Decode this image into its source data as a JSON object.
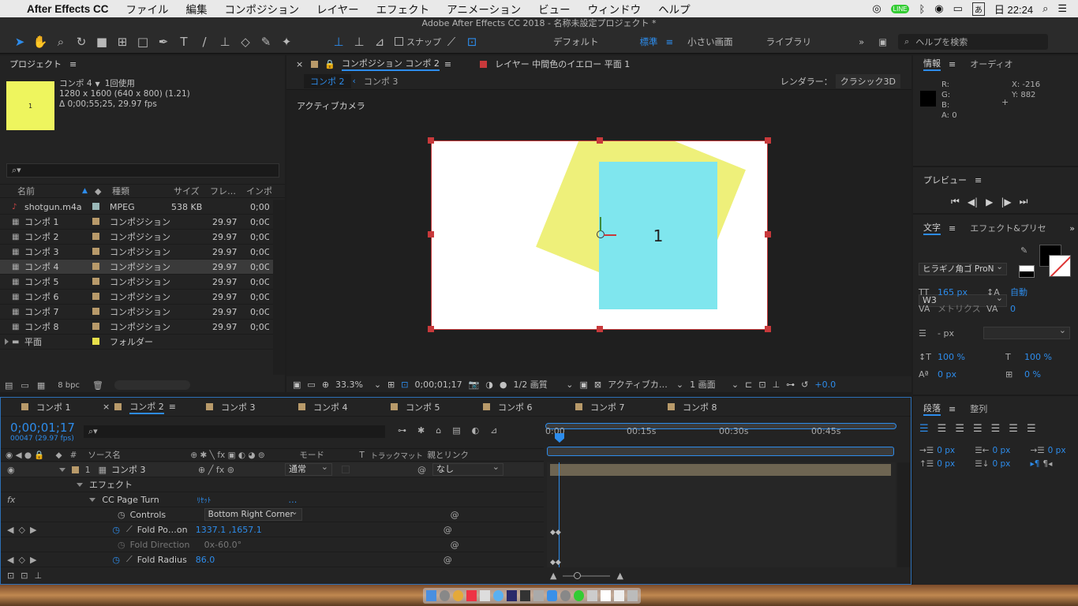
{
  "menubar": {
    "app": "After Effects CC",
    "items": [
      "ファイル",
      "編集",
      "コンポジション",
      "レイヤー",
      "エフェクト",
      "アニメーション",
      "ビュー",
      "ウィンドウ",
      "ヘルプ"
    ],
    "clock": "日 22:24"
  },
  "titlebar": "Adobe After Effects CC 2018 - 名称未設定プロジェクト *",
  "toolbar": {
    "snap": "スナップ",
    "workspaces": [
      "デフォルト",
      "標準",
      "小さい画面",
      "ライブラリ"
    ],
    "active_workspace": "標準",
    "help_placeholder": "ヘルプを検索"
  },
  "project": {
    "title": "プロジェクト",
    "item_name": "コンポ 4",
    "usage": "1回使用",
    "dims": "1280 x 1600  (640 x 800) (1.21)",
    "duration": "Δ 0;00;55;25, 29.97 fps",
    "thumb_text": "1",
    "columns": [
      "名前",
      "種類",
      "サイズ",
      "フレ…",
      "インポ"
    ],
    "rows": [
      {
        "name": "shotgun.m4a",
        "type": "MPEG",
        "size": "538 KB",
        "fps": "",
        "in": "0;00",
        "color": "#9ab8b8"
      },
      {
        "name": "コンポ 1",
        "type": "コンポジション",
        "size": "",
        "fps": "29.97",
        "in": "0;0C",
        "color": "#b89a6a"
      },
      {
        "name": "コンポ 2",
        "type": "コンポジション",
        "size": "",
        "fps": "29.97",
        "in": "0;0C",
        "color": "#b89a6a"
      },
      {
        "name": "コンポ 3",
        "type": "コンポジション",
        "size": "",
        "fps": "29.97",
        "in": "0;0C",
        "color": "#b89a6a"
      },
      {
        "name": "コンポ 4",
        "type": "コンポジション",
        "size": "",
        "fps": "29.97",
        "in": "0;0C",
        "color": "#b89a6a"
      },
      {
        "name": "コンポ 5",
        "type": "コンポジション",
        "size": "",
        "fps": "29.97",
        "in": "0;0C",
        "color": "#b89a6a"
      },
      {
        "name": "コンポ 6",
        "type": "コンポジション",
        "size": "",
        "fps": "29.97",
        "in": "0;0C",
        "color": "#b89a6a"
      },
      {
        "name": "コンポ 7",
        "type": "コンポジション",
        "size": "",
        "fps": "29.97",
        "in": "0;0C",
        "color": "#b89a6a"
      },
      {
        "name": "コンポ 8",
        "type": "コンポジション",
        "size": "",
        "fps": "29.97",
        "in": "0;0C",
        "color": "#b89a6a"
      },
      {
        "name": "平面",
        "type": "フォルダー",
        "size": "",
        "fps": "",
        "in": "",
        "color": "#e8e04a"
      }
    ],
    "bpc": "8 bpc"
  },
  "viewer": {
    "tab_comp": "コンポジション コンポ 2",
    "tab_layer": "レイヤー 中間色のイエロー 平面 1",
    "breadcrumb": [
      "コンポ 2",
      "コンポ 3"
    ],
    "renderer_label": "レンダラー：",
    "renderer": "クラシック3D",
    "camera": "アクティブカメラ",
    "canvas_text": "1",
    "zoom": "33.3%",
    "timecode": "0;00;01;17",
    "resolution": "1/2 画質",
    "view": "アクティブカ…",
    "layout": "1 画面",
    "exposure": "+0.0"
  },
  "timeline": {
    "tabs": [
      "コンポ 1",
      "コンポ 2",
      "コンポ 3",
      "コンポ 4",
      "コンポ 5",
      "コンポ 6",
      "コンポ 7",
      "コンポ 8"
    ],
    "active_tab": "コンポ 2",
    "timecode": "0;00;01;17",
    "frame_info": "00047 (29.97 fps)",
    "ruler": [
      "0:00",
      "00:15s",
      "00:30s",
      "00:45s"
    ],
    "col_source": "ソース名",
    "col_mode": "モード",
    "col_t": "T",
    "col_track": "トラックマット",
    "col_parent": "親とリンク",
    "layer_num": "1",
    "layer_name": "コンポ 3",
    "layer_mode": "通常",
    "layer_parent": "なし",
    "effects": "エフェクト",
    "effect_name": "CC Page Turn",
    "reset": "ﾘｾｯﾄ",
    "dots": "…",
    "controls_label": "Controls",
    "controls_value": "Bottom Right Corner",
    "fold_pos_label": "Fold Po…on",
    "fold_pos_value": "1337.1 ,1657.1",
    "fold_dir_label": "Fold Direction",
    "fold_dir_value": "0x-60.0°",
    "fold_radius_label": "Fold Radius",
    "fold_radius_value": "86.0",
    "fx": "fx",
    "num_col": "#"
  },
  "info": {
    "title": "情報",
    "audio": "オーディオ",
    "r": "R:",
    "g": "G:",
    "b": "B:",
    "a": "A: 0",
    "x": "X: -216",
    "y": "Y: 882"
  },
  "preview": {
    "title": "プレビュー"
  },
  "character": {
    "title": "文字",
    "effects_tab": "エフェクト&プリセ",
    "font": "ヒラギノ角ゴ ProN",
    "weight": "W3",
    "size": "165 px",
    "leading": "自動",
    "kerning": "メトリクス",
    "tracking": "0",
    "stroke": "- px",
    "vscale": "100 %",
    "hscale": "100 %",
    "baseline": "0 px",
    "tsume": "0 %"
  },
  "paragraph": {
    "title": "段落",
    "align_tab": "整列",
    "values": [
      "0 px",
      "0 px",
      "0 px",
      "0 px",
      "0 px"
    ]
  }
}
